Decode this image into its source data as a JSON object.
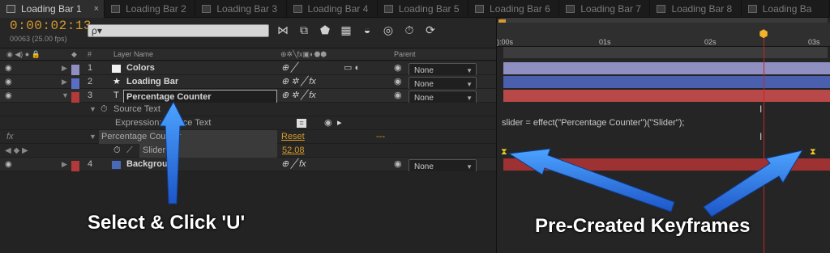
{
  "tabs": [
    {
      "label": "Loading Bar 1",
      "active": true
    },
    {
      "label": "Loading Bar 2"
    },
    {
      "label": "Loading Bar 3"
    },
    {
      "label": "Loading Bar 4"
    },
    {
      "label": "Loading Bar 5"
    },
    {
      "label": "Loading Bar 6"
    },
    {
      "label": "Loading Bar 7"
    },
    {
      "label": "Loading Bar 8"
    },
    {
      "label": "Loading Ba"
    }
  ],
  "tab_close": "×",
  "header": {
    "timecode": "0:00:02:13",
    "frame_info": "00063 (25.00 fps)",
    "search_placeholder": "ρ▾"
  },
  "columns": {
    "layer_name": "Layer Name",
    "parent": "Parent",
    "hash": "#"
  },
  "layers": [
    {
      "num": "1",
      "name": "Colors",
      "color": "#8f8fc2",
      "type_icon": "solid-icon",
      "parent": "None"
    },
    {
      "num": "2",
      "name": "Loading Bar",
      "color": "#5a6ec4",
      "type_icon": "star-icon",
      "parent": "None"
    },
    {
      "num": "3",
      "name": "Percentage Counter",
      "color": "#b23a3a",
      "type_icon": "text-icon",
      "parent": "None"
    },
    {
      "num": "4",
      "name": "Background",
      "color": "#b23a3a",
      "parent": "None"
    }
  ],
  "properties": {
    "source_text": "Source Text",
    "expression_label": "Expression: Source Text",
    "effect_name": "Percentage Counter",
    "reset": "Reset",
    "dashes": "---",
    "slider_label": "Slider",
    "slider_value": "52.08",
    "fx": "fx"
  },
  "timeline": {
    "ticks": [
      "):00s",
      "01s",
      "02s",
      "03s"
    ],
    "expression": "slider = effect(\"Percentage Counter\")(\"Slider\");"
  },
  "annotations": {
    "left": "Select & Click 'U'",
    "right": "Pre-Created Keyframes"
  },
  "colors": {
    "accent": "#d89a2c",
    "arrow": "#2e7de6",
    "cti": "#c42525",
    "keyframe": "#e7c629"
  }
}
